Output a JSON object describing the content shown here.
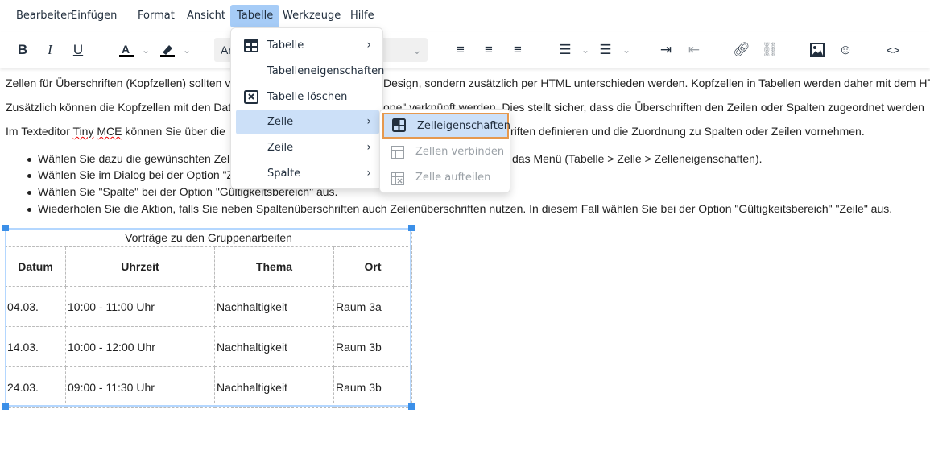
{
  "menubar": [
    "Bearbeiten",
    "Einfügen",
    "Format",
    "Ansicht",
    "Tabelle",
    "Werkzeuge",
    "Hilfe"
  ],
  "toolbar": {
    "bold": "B",
    "italic": "I",
    "underline": "U",
    "font_family": "Ar"
  },
  "paragraphs": [
    {
      "left": "Zellen für Überschriften (Kopfzellen) sollten v",
      "right": "Design, sondern zusätzlich per HTML unterschieden werden. Kopfzellen in Tabellen werden daher mit dem HT"
    },
    {
      "left": "Zusätzlich können die Kopfzellen mit den Dat",
      "right": "ope\" verknüpft werden. Dies stellt sicher, dass die Überschriften den Zeilen oder Spalten zugeordnet werden"
    },
    {
      "left_a": "Im Texteditor ",
      "tiny": "Tiny",
      "space": " ",
      "mce": "MCE",
      "left_b": " können Sie über die ",
      "right": "riften definieren und die Zuordnung zu Spalten oder Zeilen vornehmen."
    }
  ],
  "bullets": [
    {
      "left": "Wählen Sie dazu die gewünschten Zel",
      "right": "das Menü (Tabelle > Zelle > Zelleneigenschaften)."
    },
    {
      "left": "Wählen Sie im Dialog bei der Option \"Z"
    },
    {
      "left": "Wählen Sie \"Spalte\" bei der Option \"Gültigkeitsbereich\" aus."
    },
    {
      "left": "Wiederholen Sie die Aktion, falls Sie neben Spaltenüberschriften auch Zeilenüberschriften nutzen. In diesem Fall wählen Sie bei der Option \"Gültigkeitsbereich\" \"Zeile\" aus."
    }
  ],
  "table": {
    "caption": "Vorträge zu den Gruppenarbeiten",
    "headers": [
      "Datum",
      "Uhrzeit",
      "Thema",
      "Ort"
    ],
    "rows": [
      [
        "04.03.",
        "10:00 - 11:00 Uhr",
        "Nachhaltigkeit",
        "Raum 3a"
      ],
      [
        "14.03.",
        "10:00 - 12:00 Uhr",
        "Nachhaltigkeit",
        "Raum 3b"
      ],
      [
        "24.03.",
        "09:00 - 11:30 Uhr",
        "Nachhaltigkeit",
        "Raum 3b"
      ]
    ]
  },
  "table_menu": [
    "Tabelle",
    "Tabelleneigenschaften",
    "Tabelle löschen",
    "Zelle",
    "Zeile",
    "Spalte"
  ],
  "cell_submenu": [
    "Zelleigenschaften",
    "Zellen verbinden",
    "Zelle aufteilen"
  ],
  "colors": {
    "accent": "#a6ccf7",
    "highlight": "#cce0f8",
    "focus_border": "#e6994f",
    "selection": "#3b8fe8"
  }
}
